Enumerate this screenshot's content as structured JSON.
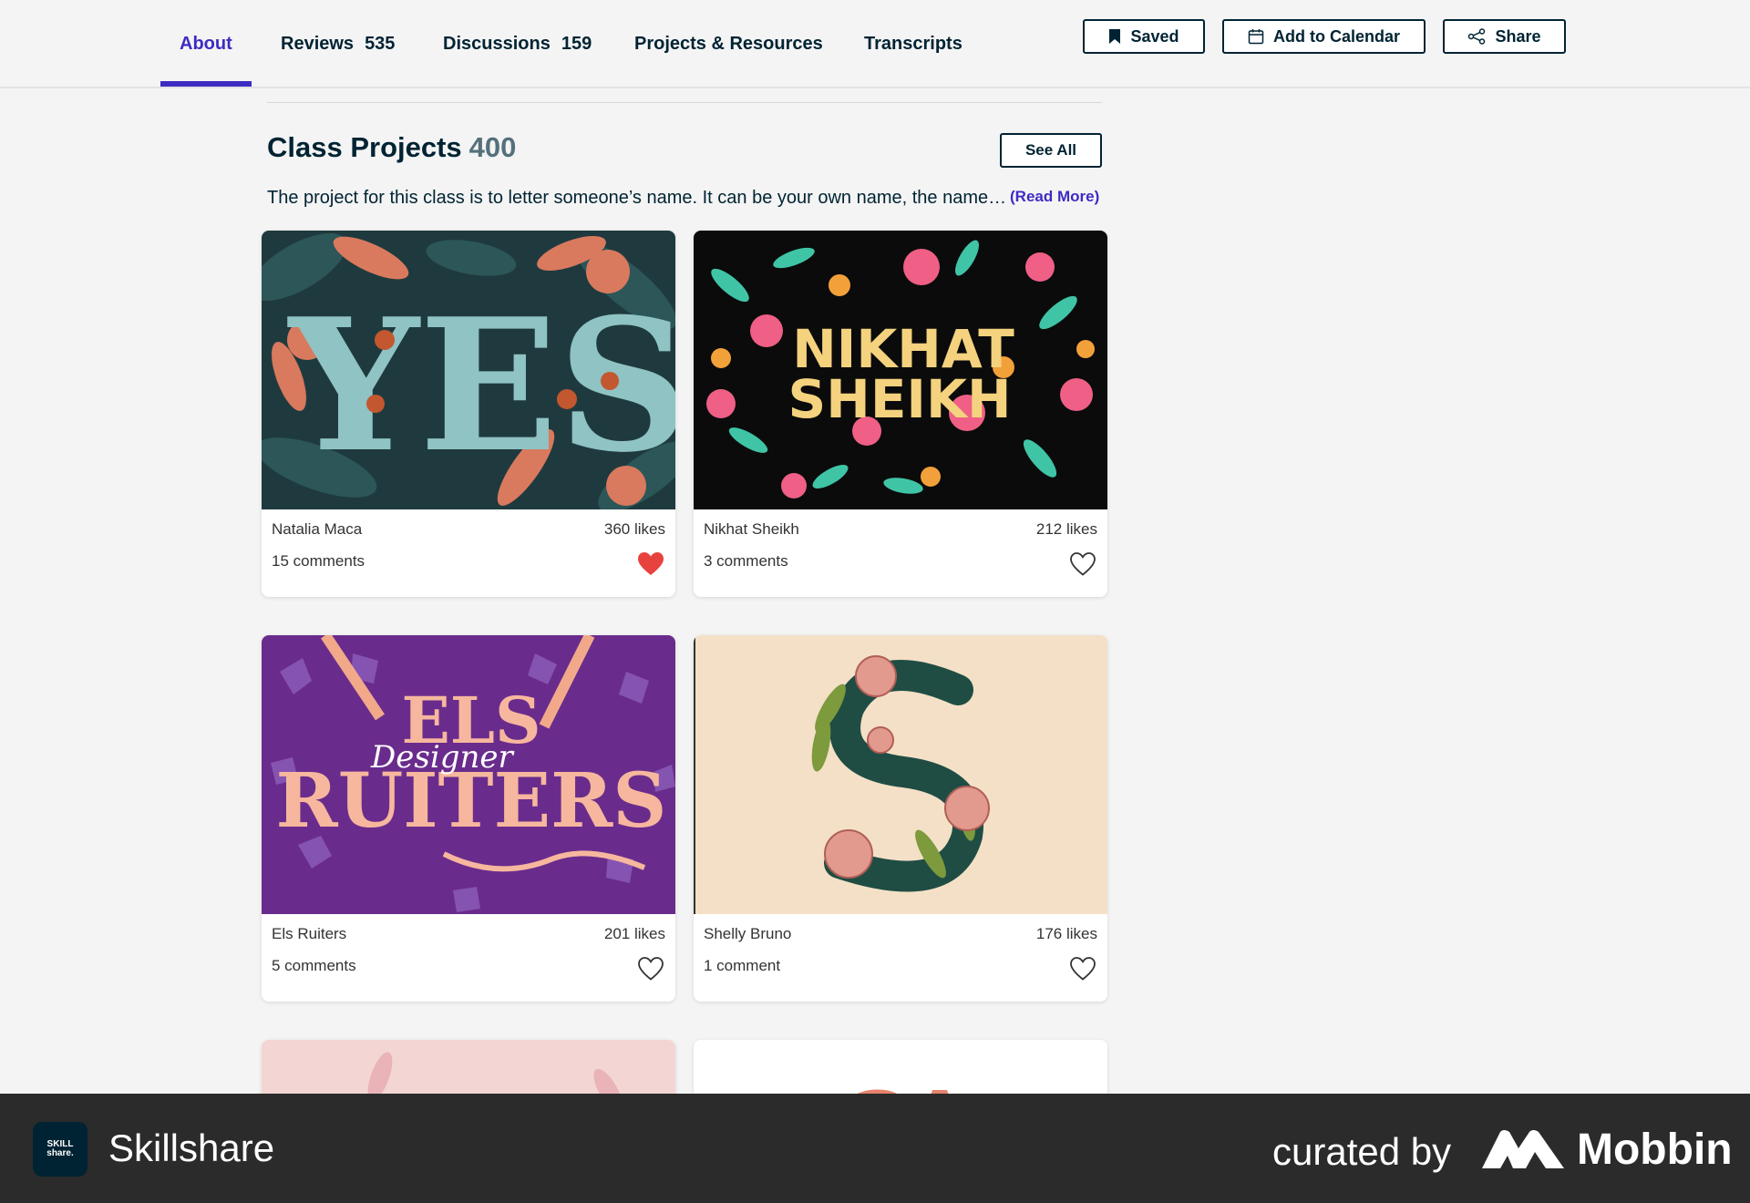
{
  "nav": {
    "tabs": [
      {
        "label": "About",
        "count": ""
      },
      {
        "label": "Reviews",
        "count": "535"
      },
      {
        "label": "Discussions",
        "count": "159"
      },
      {
        "label": "Projects & Resources",
        "count": ""
      },
      {
        "label": "Transcripts",
        "count": ""
      }
    ],
    "active_tab": "About",
    "saved_label": "Saved",
    "calendar_label": "Add to Calendar",
    "share_label": "Share"
  },
  "projects": {
    "title": "Class Projects",
    "count": "400",
    "see_all_label": "See All",
    "description": "The project for this class is to letter someone’s name. It can be your own name, the name…",
    "read_more_label": "(Read More)",
    "cards": [
      {
        "author": "Natalia Maca",
        "likes": "360 likes",
        "comments": "15 comments",
        "liked": true,
        "art_text": "YES"
      },
      {
        "author": "Nikhat Sheikh",
        "likes": "212 likes",
        "comments": "3 comments",
        "liked": false,
        "art_text": "NIKHAT SHEIKH"
      },
      {
        "author": "Els Ruiters",
        "likes": "201 likes",
        "comments": "5 comments",
        "liked": false,
        "art_text": "ELS Designer RUITERS"
      },
      {
        "author": "Shelly Bruno",
        "likes": "176 likes",
        "comments": "1 comment",
        "liked": false,
        "art_text": "S"
      }
    ]
  },
  "footer": {
    "app_name": "Skillshare",
    "app_logo_text": "SKILL share.",
    "curated_by": "curated by",
    "brand": "Mobbin"
  },
  "colors": {
    "accent": "#3d2cc2",
    "text_dark": "#002333",
    "heart_liked": "#e8423f",
    "footer_bg": "#2b2b2b"
  },
  "icons": [
    "bookmark-icon",
    "calendar-icon",
    "share-icon",
    "heart-icon",
    "heart-filled-icon"
  ]
}
